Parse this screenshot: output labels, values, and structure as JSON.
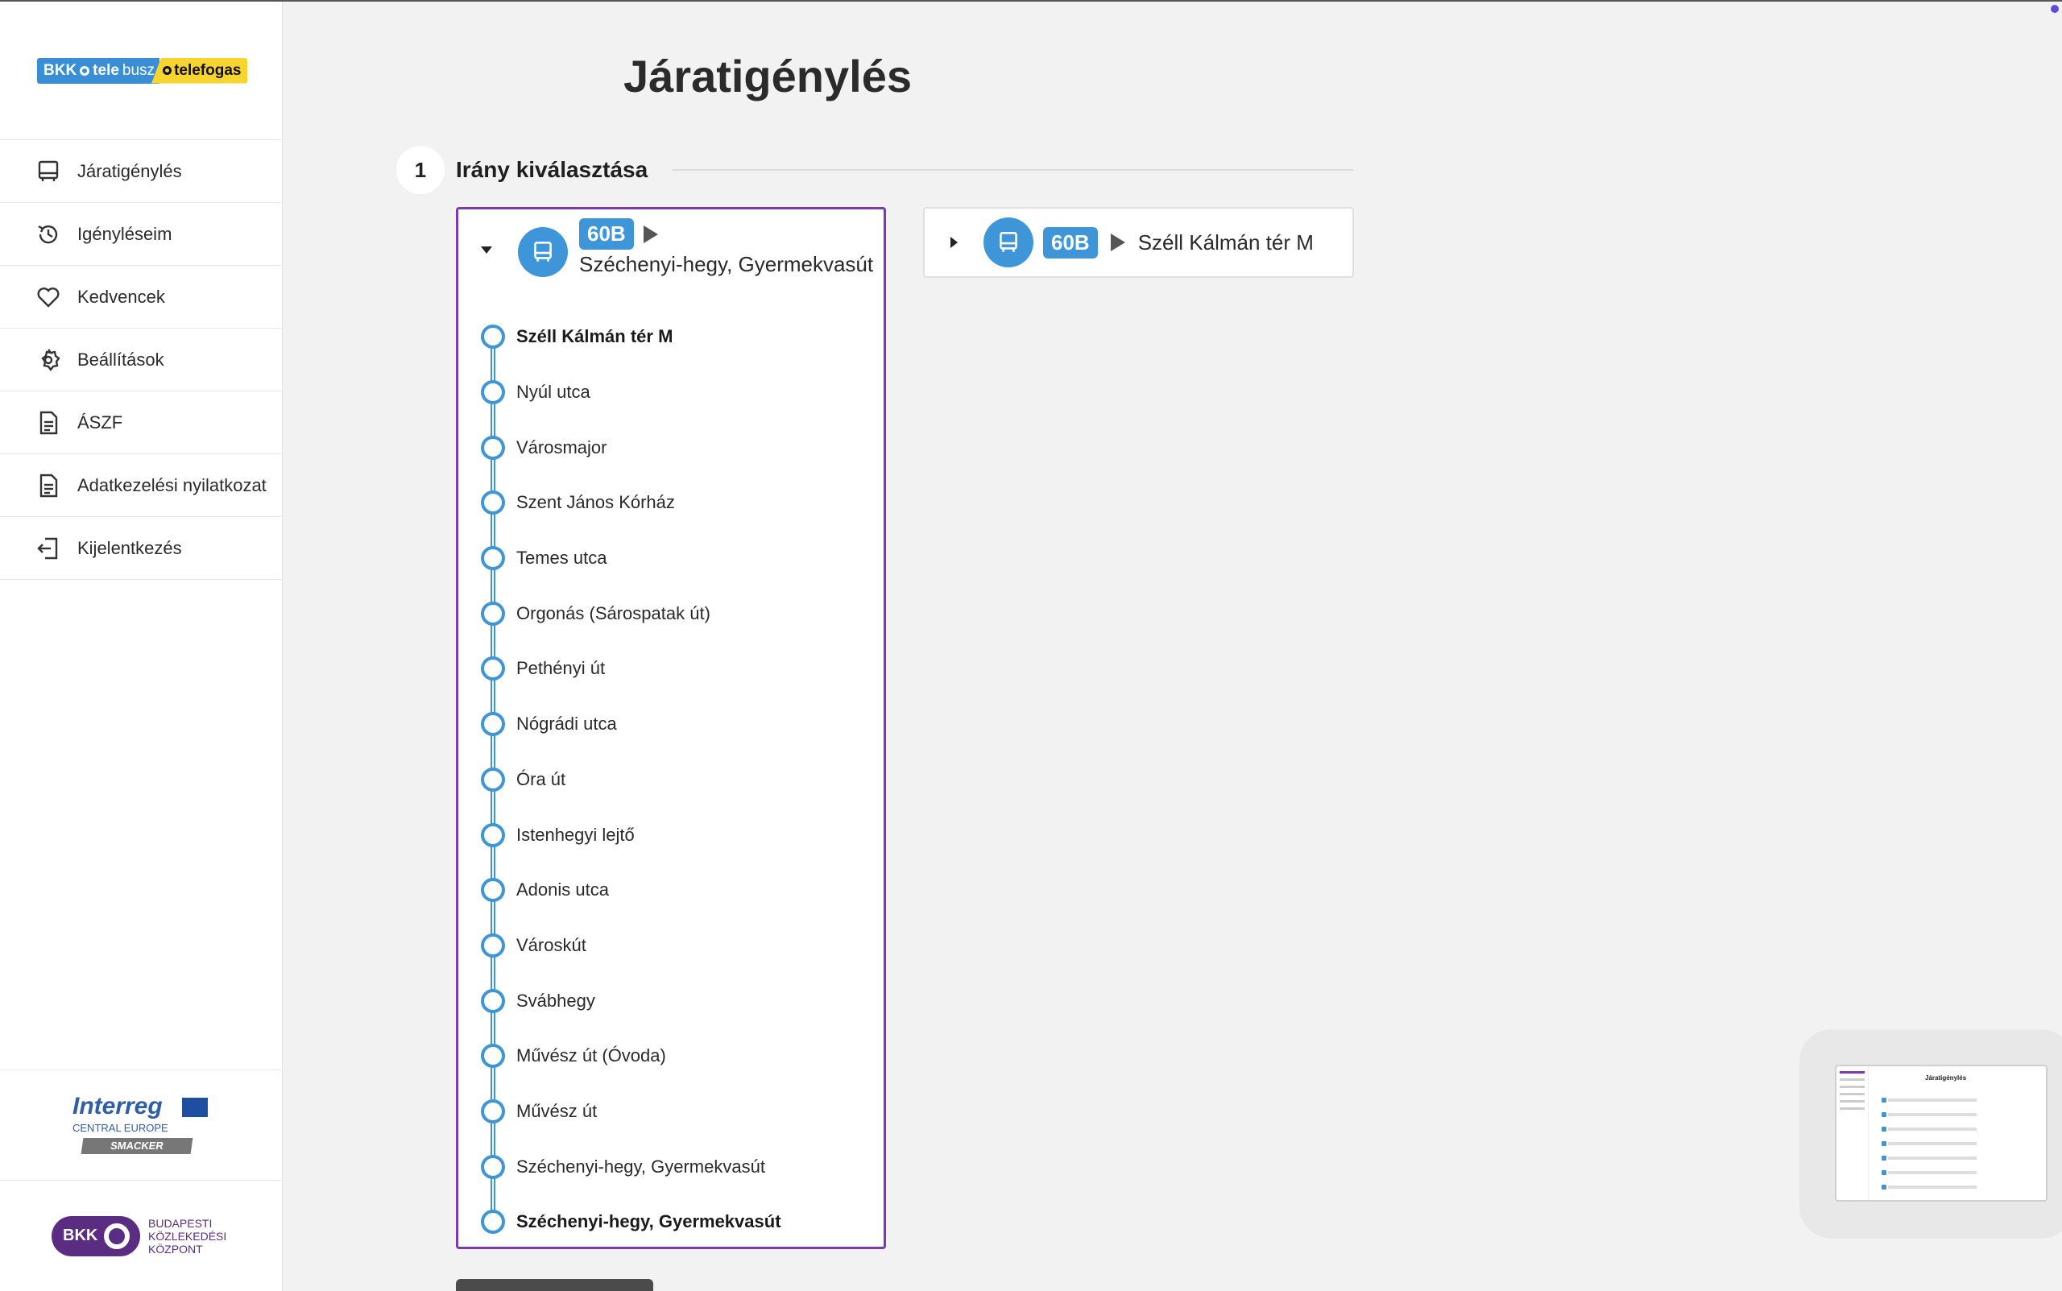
{
  "sidebar": {
    "logo": {
      "bkk": "BKK",
      "tele": "tele",
      "busz": "busz",
      "telefogas": "telefogas"
    },
    "items": [
      {
        "label": "Járatigénylés",
        "icon": "bus-icon"
      },
      {
        "label": "Igényléseim",
        "icon": "history-icon"
      },
      {
        "label": "Kedvencek",
        "icon": "heart-icon"
      },
      {
        "label": "Beállítások",
        "icon": "gear-icon"
      },
      {
        "label": "ÁSZF",
        "icon": "document-icon"
      },
      {
        "label": "Adatkezelési nyilatkozat",
        "icon": "document-icon"
      },
      {
        "label": "Kijelentkezés",
        "icon": "logout-icon"
      }
    ],
    "interreg": {
      "name": "Interreg",
      "region": "CENTRAL EUROPE",
      "project": "SMACKER"
    },
    "bkk": {
      "abbr": "BKK",
      "line1": "BUDAPESTI",
      "line2": "KÖZLEKEDÉSI",
      "line3": "KÖZPONT"
    }
  },
  "main": {
    "title": "Járatigénylés",
    "step": {
      "number": "1",
      "label": "Irány kiválasztása"
    }
  },
  "directions": [
    {
      "route": "60B",
      "destination": "Széchenyi-hegy, Gyermekvasút",
      "expanded": true,
      "stops": [
        {
          "name": "Széll Kálmán tér M",
          "bold": true
        },
        {
          "name": "Nyúl utca"
        },
        {
          "name": "Városmajor"
        },
        {
          "name": "Szent János Kórház"
        },
        {
          "name": "Temes utca"
        },
        {
          "name": "Orgonás (Sárospatak út)"
        },
        {
          "name": "Pethényi út"
        },
        {
          "name": "Nógrádi utca"
        },
        {
          "name": "Óra út"
        },
        {
          "name": "Istenhegyi lejtő"
        },
        {
          "name": "Adonis utca"
        },
        {
          "name": "Városkút"
        },
        {
          "name": "Svábhegy"
        },
        {
          "name": "Művész út (Óvoda)"
        },
        {
          "name": "Művész út"
        },
        {
          "name": "Széchenyi-hegy, Gyermekvasút"
        },
        {
          "name": "Széchenyi-hegy, Gyermekvasút",
          "bold": true
        }
      ]
    },
    {
      "route": "60B",
      "destination": "Széll Kálmán tér M",
      "expanded": false
    }
  ],
  "preview": {
    "title": "Járatigénylés"
  },
  "colors": {
    "accent": "#7b3ab0",
    "route_blue": "#3e95d8",
    "logo_yellow": "#f7d42e"
  }
}
